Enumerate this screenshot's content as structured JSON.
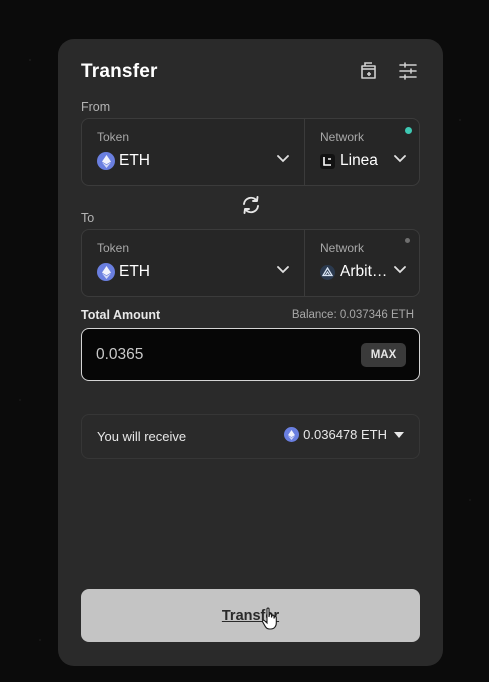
{
  "header": {
    "title": "Transfer",
    "icons": [
      "wallet-add-icon",
      "sliders-icon"
    ]
  },
  "from": {
    "label": "From",
    "token_label": "Token",
    "token_value": "ETH",
    "network_label": "Network",
    "network_value": "Linea",
    "status_color": "#3ec8b3"
  },
  "to": {
    "label": "To",
    "token_label": "Token",
    "token_value": "ETH",
    "network_label": "Network",
    "network_value": "Arbit…",
    "status_color": "#6f6f6f"
  },
  "amount": {
    "label": "Total Amount",
    "balance": "Balance: 0.037346 ETH",
    "value": "0.0365",
    "max_label": "MAX"
  },
  "receive": {
    "label": "You will receive",
    "value": "0.036478 ETH"
  },
  "action": {
    "transfer_label": "Transfer"
  },
  "colors": {
    "eth": "#6a7fe0",
    "card": "#2a2a2a",
    "button": "#c4c4c4"
  }
}
